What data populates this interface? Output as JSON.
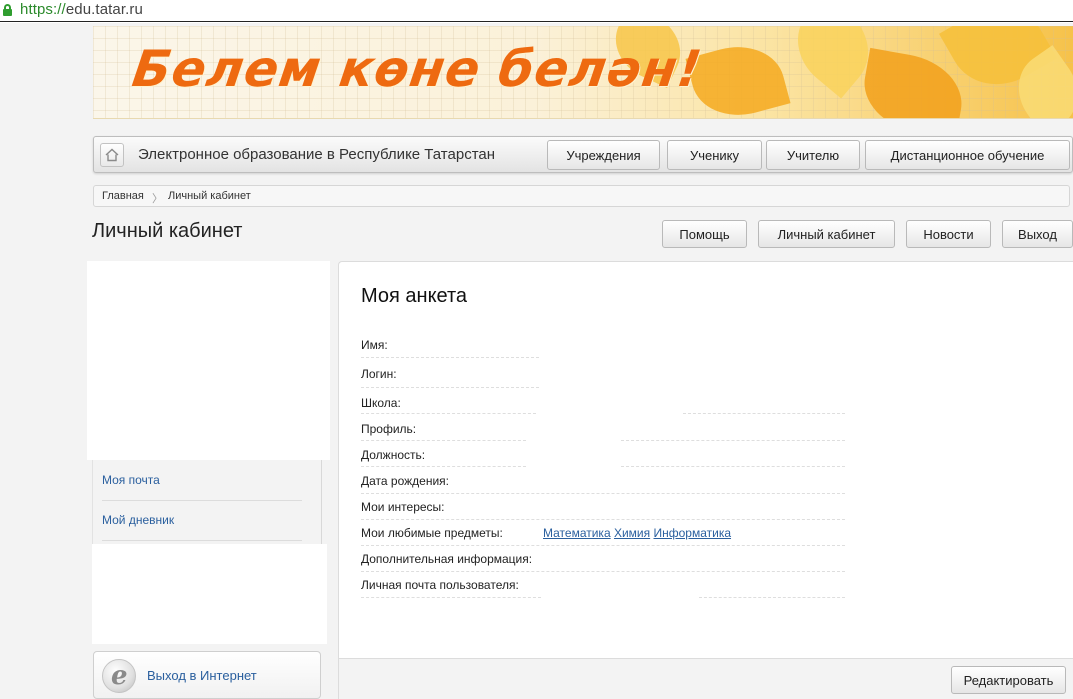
{
  "browser": {
    "url_scheme": "https://",
    "url_host": "edu.tatar.ru"
  },
  "banner": {
    "slogan": "Белем көне белән!"
  },
  "nav": {
    "site_title": "Электронное образование в Республике Татарстан",
    "items": [
      {
        "label": "Учреждения"
      },
      {
        "label": "Ученику"
      },
      {
        "label": "Учителю"
      },
      {
        "label": "Дистанционное обучение"
      }
    ]
  },
  "breadcrumb": {
    "home": "Главная",
    "separator": "〉",
    "current": "Личный кабинет"
  },
  "header": {
    "title": "Личный кабинет",
    "buttons": [
      {
        "label": "Помощь"
      },
      {
        "label": "Личный кабинет"
      },
      {
        "label": "Новости"
      },
      {
        "label": "Выход"
      }
    ]
  },
  "sidebar": {
    "links": [
      {
        "label": "Моя почта"
      },
      {
        "label": "Мой дневник"
      }
    ],
    "internet_label": "Выход в Интернет"
  },
  "profile": {
    "title": "Моя анкета",
    "fields": [
      {
        "label": "Имя:"
      },
      {
        "label": "Логин:"
      },
      {
        "label": "Школа:"
      },
      {
        "label": "Профиль:"
      },
      {
        "label": "Должность:"
      },
      {
        "label": "Дата рождения:"
      },
      {
        "label": "Мои интересы:"
      },
      {
        "label": "Мои любимые предметы:"
      },
      {
        "label": "Дополнительная информация:"
      },
      {
        "label": "Личная почта пользователя:"
      }
    ],
    "favorite_subjects": [
      "Математика",
      "Химия",
      "Информатика"
    ],
    "edit_label": "Редактировать"
  },
  "colors": {
    "accent_orange": "#ee6a10",
    "link_blue": "#2a5f9e",
    "secure_green": "#2f9d2f"
  }
}
